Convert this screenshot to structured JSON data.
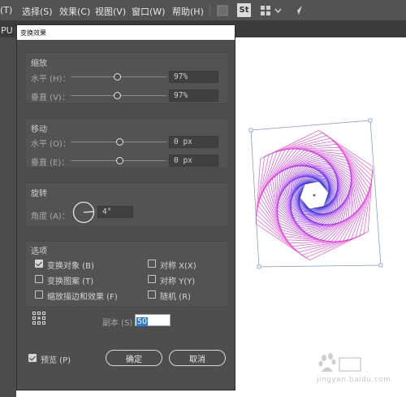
{
  "menubar": {
    "items": [
      "(T)",
      "选择(S)",
      "效果(C)",
      "视图(V)",
      "窗口(W)",
      "帮助(H)"
    ],
    "st_label": "St"
  },
  "doc_tab": {
    "label": "PU 频"
  },
  "dialog": {
    "title": "变换效果",
    "scale": {
      "title": "缩放",
      "horizontal_label": "水平 (H)：",
      "horizontal_value": 97,
      "horizontal_text": "97%",
      "vertical_label": "垂直 (V)：",
      "vertical_value": 97,
      "vertical_text": "97%"
    },
    "move": {
      "title": "移动",
      "horizontal_label": "水平 (O)：",
      "horizontal_text": "0 px",
      "vertical_label": "垂直 (E)：",
      "vertical_text": "0 px"
    },
    "rotate": {
      "title": "旋转",
      "angle_label": "角度 (A)：",
      "angle_text": "4°"
    },
    "options": {
      "title": "选项",
      "transform_objects": {
        "label": "变换对象 (B)",
        "checked": true
      },
      "transform_patterns": {
        "label": "变换图案 (T)",
        "checked": false
      },
      "scale_strokes": {
        "label": "缩放描边和效果 (F)",
        "checked": false
      },
      "reflect_x": {
        "label": "对称 X(X)",
        "checked": false
      },
      "reflect_y": {
        "label": "对称 Y(Y)",
        "checked": false
      },
      "random": {
        "label": "随机 (R)",
        "checked": false
      }
    },
    "copies_label": "副本 (S)",
    "copies_value": "50",
    "preview": {
      "label": "预览 (P)",
      "checked": true
    },
    "ok_label": "确定",
    "cancel_label": "取消"
  },
  "artwork": {
    "colors": [
      "#ff33cc",
      "#9933ff",
      "#3333cc"
    ]
  },
  "watermark": {
    "url": "jingyan.baidu.com"
  },
  "colors": {
    "menubar": "#535353",
    "dialog": "#4e4e4e",
    "accent": "#2e7dd6"
  }
}
